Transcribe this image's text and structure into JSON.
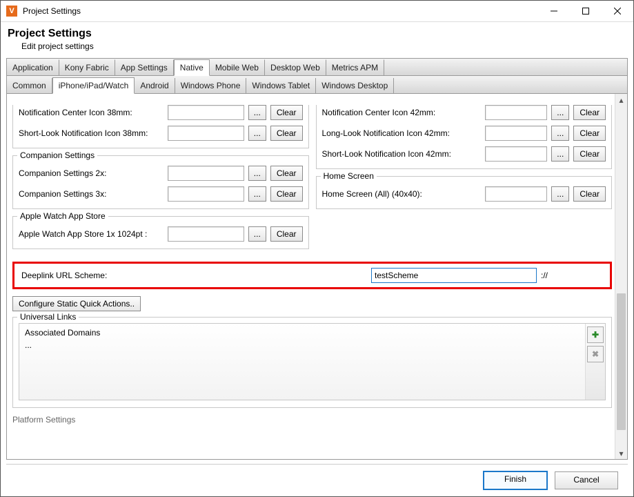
{
  "window": {
    "title": "Project Settings"
  },
  "header": {
    "title": "Project Settings",
    "subtitle": "Edit project settings"
  },
  "tabs": {
    "main": [
      "Application",
      "Kony Fabric",
      "App Settings",
      "Native",
      "Mobile Web",
      "Desktop Web",
      "Metrics APM"
    ],
    "main_active": "Native",
    "sub": [
      "Common",
      "iPhone/iPad/Watch",
      "Android",
      "Windows Phone",
      "Windows Tablet",
      "Windows Desktop"
    ],
    "sub_active": "iPhone/iPad/Watch"
  },
  "buttons": {
    "browse": "...",
    "clear": "Clear",
    "finish": "Finish",
    "cancel": "Cancel",
    "configure_quick_actions": "Configure Static Quick Actions.."
  },
  "left": {
    "top_rows": [
      {
        "label": "Notification Center Icon 38mm:",
        "value": ""
      },
      {
        "label": "Short-Look Notification Icon 38mm:",
        "value": ""
      }
    ],
    "companion": {
      "title": "Companion Settings",
      "rows": [
        {
          "label": "Companion Settings 2x:",
          "value": ""
        },
        {
          "label": "Companion Settings 3x:",
          "value": ""
        }
      ]
    },
    "appstore": {
      "title": "Apple Watch App Store",
      "rows": [
        {
          "label": "Apple Watch App Store 1x 1024pt :",
          "value": ""
        }
      ]
    }
  },
  "right": {
    "top_rows": [
      {
        "label": "Notification Center Icon 42mm:",
        "value": ""
      },
      {
        "label": "Long-Look Notification Icon 42mm:",
        "value": ""
      },
      {
        "label": "Short-Look Notification Icon 42mm:",
        "value": ""
      }
    ],
    "home": {
      "title": "Home Screen",
      "rows": [
        {
          "label": "Home Screen (All) (40x40):",
          "value": ""
        }
      ]
    }
  },
  "deeplink": {
    "label": "Deeplink URL Scheme:",
    "value": "testScheme",
    "suffix": "://"
  },
  "universal_links": {
    "title": "Universal Links",
    "line1": "Associated Domains",
    "line2": "..."
  },
  "cutoff_section": "Platform Settings"
}
